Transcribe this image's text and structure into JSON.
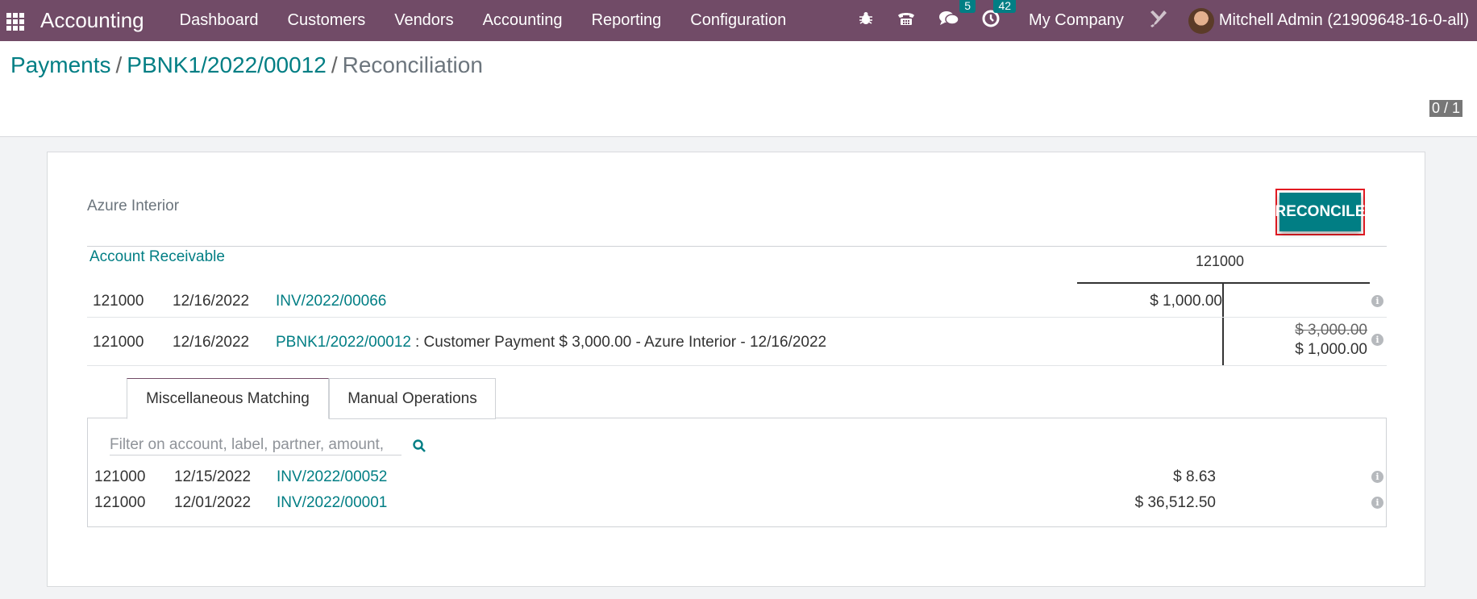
{
  "navbar": {
    "brand": "Accounting",
    "menu": [
      "Dashboard",
      "Customers",
      "Vendors",
      "Accounting",
      "Reporting",
      "Configuration"
    ],
    "messages_count": "5",
    "activities_count": "42",
    "company": "My Company",
    "user": "Mitchell Admin (21909648-16-0-all)"
  },
  "breadcrumb": {
    "payments": "Payments",
    "payment": "PBNK1/2022/00012",
    "current": "Reconciliation",
    "separator": "/"
  },
  "pager": "0 / 1",
  "reconcile": {
    "partner": "Azure Interior",
    "button": "RECONCILE",
    "account_title": "Account Receivable",
    "account_code_header": "121000",
    "lines": [
      {
        "account": "121000",
        "date": "12/16/2022",
        "ref": "INV/2022/00066",
        "label": "",
        "debit": "$ 1,000.00",
        "credit_original": "",
        "credit": ""
      },
      {
        "account": "121000",
        "date": "12/16/2022",
        "ref": "PBNK1/2022/00012",
        "label": ": Customer Payment $ 3,000.00 - Azure Interior - 12/16/2022",
        "debit": "",
        "credit_original": "$ 3,000.00",
        "credit": "$ 1,000.00"
      }
    ]
  },
  "tabs": {
    "misc": "Miscellaneous Matching",
    "manual": "Manual Operations"
  },
  "matching": {
    "filter_placeholder": "Filter on account, label, partner, amount,",
    "rows": [
      {
        "account": "121000",
        "date": "12/15/2022",
        "ref": "INV/2022/00052",
        "amount": "$ 8.63"
      },
      {
        "account": "121000",
        "date": "12/01/2022",
        "ref": "INV/2022/00001",
        "amount": "$ 36,512.50"
      }
    ]
  },
  "colors": {
    "navbar": "#714b67",
    "accent": "#017e84",
    "highlight_border": "#e31b23"
  }
}
